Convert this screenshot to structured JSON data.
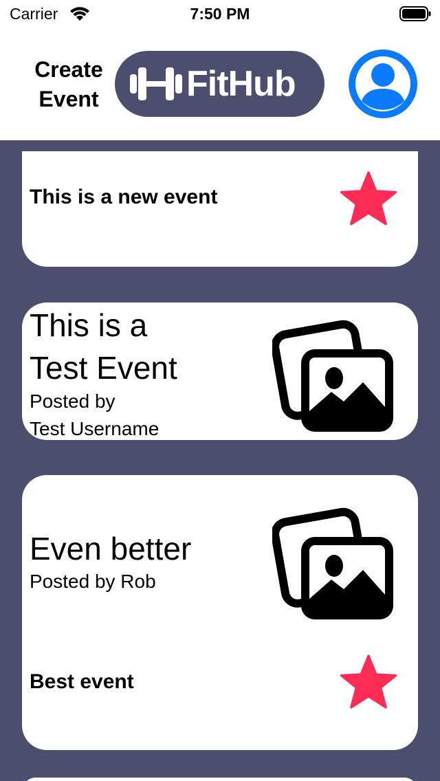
{
  "status_bar": {
    "carrier": "Carrier",
    "time": "7:50 PM"
  },
  "header": {
    "create_event_line1": "Create",
    "create_event_line2": "Event",
    "logo_text": "FitHub",
    "profile_icon": "person-circle-icon"
  },
  "colors": {
    "background": "#4b4e6d",
    "star": "#ff2d55",
    "profile": "#0a7aff",
    "card": "#ffffff"
  },
  "events": [
    {
      "description": "This is a new event",
      "icon": "star-icon"
    },
    {
      "title_line1": "This is a",
      "title_line2": "Test Event",
      "posted_line1": "Posted by",
      "posted_line2": "Test Username",
      "icon": "photo-stack-icon"
    },
    {
      "title": "Even better",
      "posted": "Posted by Rob",
      "description": "Best event",
      "icon": "photo-stack-icon"
    }
  ]
}
